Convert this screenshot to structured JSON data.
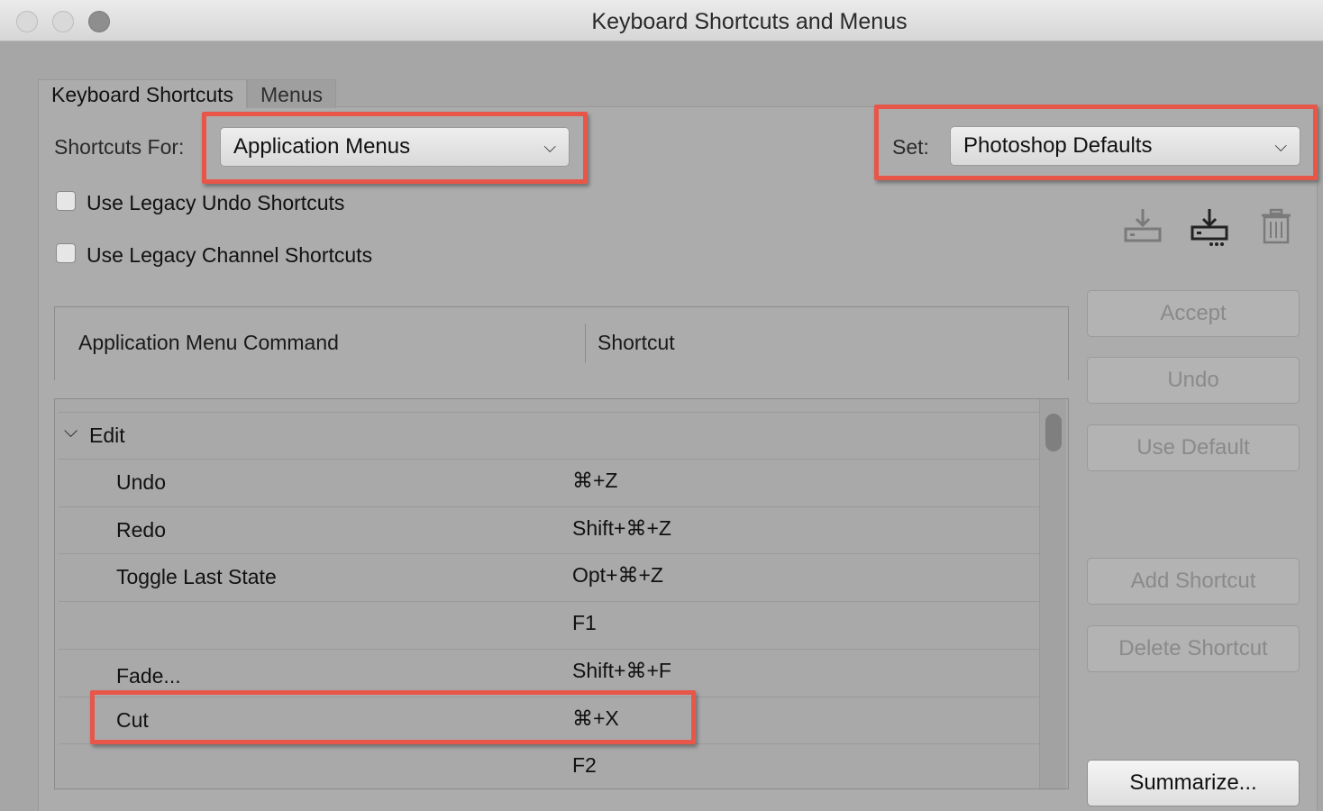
{
  "window": {
    "title": "Keyboard Shortcuts and Menus"
  },
  "tabs": [
    {
      "label": "Keyboard Shortcuts",
      "active": true
    },
    {
      "label": "Menus",
      "active": false
    }
  ],
  "shortcuts_for": {
    "label": "Shortcuts For:",
    "value": "Application Menus"
  },
  "set": {
    "label": "Set:",
    "value": "Photoshop Defaults"
  },
  "options": [
    {
      "label": "Use Legacy Undo Shortcuts",
      "checked": false
    },
    {
      "label": "Use Legacy Channel Shortcuts",
      "checked": false
    }
  ],
  "icons": {
    "save": "save-set-icon",
    "save_as": "save-as-set-icon",
    "delete": "trash-icon"
  },
  "table": {
    "columns": [
      "Application Menu Command",
      "Shortcut"
    ],
    "rows": [
      {
        "command": "Edit",
        "shortcut": "",
        "group": true
      },
      {
        "command": "Undo",
        "shortcut": "⌘+Z"
      },
      {
        "command": "Redo",
        "shortcut": "Shift+⌘+Z"
      },
      {
        "command": "Toggle Last State",
        "shortcut": "Opt+⌘+Z"
      },
      {
        "command": "",
        "shortcut": "F1"
      },
      {
        "command": "Fade...",
        "shortcut": "Shift+⌘+F"
      },
      {
        "command": "Cut",
        "shortcut": "⌘+X"
      },
      {
        "command": "",
        "shortcut": "F2"
      }
    ]
  },
  "buttons": {
    "accept": "Accept",
    "undo": "Undo",
    "use_default": "Use Default",
    "add_shortcut": "Add Shortcut",
    "delete_shortcut": "Delete Shortcut",
    "summarize": "Summarize..."
  },
  "colors": {
    "highlight": "#e8564a",
    "background": "#acacac"
  }
}
